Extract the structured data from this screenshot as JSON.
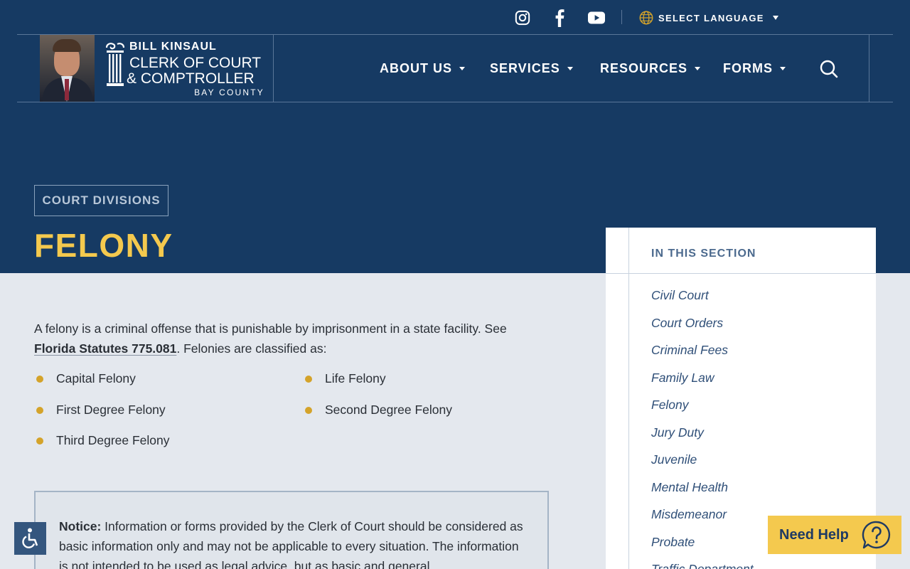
{
  "topbar": {
    "social": [
      {
        "name": "instagram",
        "icon": "instagram-icon"
      },
      {
        "name": "facebook",
        "icon": "facebook-icon"
      },
      {
        "name": "youtube",
        "icon": "youtube-icon"
      }
    ],
    "language_label": "SELECT LANGUAGE",
    "language_icon": "globe-icon"
  },
  "logo": {
    "name": "BILL KINSAUL",
    "line1": "CLERK OF COURT",
    "line2": "& COMPTROLLER",
    "county": "BAY COUNTY"
  },
  "nav": {
    "items": [
      {
        "label": "ABOUT US"
      },
      {
        "label": "SERVICES"
      },
      {
        "label": "RESOURCES"
      },
      {
        "label": "FORMS"
      }
    ],
    "search_icon": "search-icon"
  },
  "hero": {
    "badge": "COURT DIVISIONS",
    "title": "FELONY"
  },
  "content": {
    "intro_pre": "A felony is a criminal offense that is punishable by imprisonment in a state facility. See ",
    "intro_link": "Florida Statutes 775.081",
    "intro_post": ". Felonies are classified as:",
    "classes": [
      "Capital Felony",
      "Life Felony",
      "First Degree Felony",
      "Second Degree Felony",
      "Third Degree Felony"
    ],
    "notice_label": "Notice:",
    "notice_text": " Information or forms provided by the Clerk of Court should be considered as basic information only and may not be applicable to every situation. The information is not intended to be used as legal advice, but as basic and general"
  },
  "sidebar": {
    "heading": "IN THIS SECTION",
    "links": [
      "Civil Court",
      "Court Orders",
      "Criminal Fees",
      "Family Law",
      "Felony",
      "Jury Duty",
      "Juvenile",
      "Mental Health",
      "Misdemeanor",
      "Probate",
      "Traffic Department"
    ]
  },
  "widgets": {
    "accessibility_icon": "accessibility-icon",
    "help_label": "Need Help",
    "help_icon": "question-icon"
  },
  "colors": {
    "navy": "#163a63",
    "gold": "#f4c94e",
    "bullet": "#d4a32a",
    "page_bg": "#e4e8ee"
  }
}
